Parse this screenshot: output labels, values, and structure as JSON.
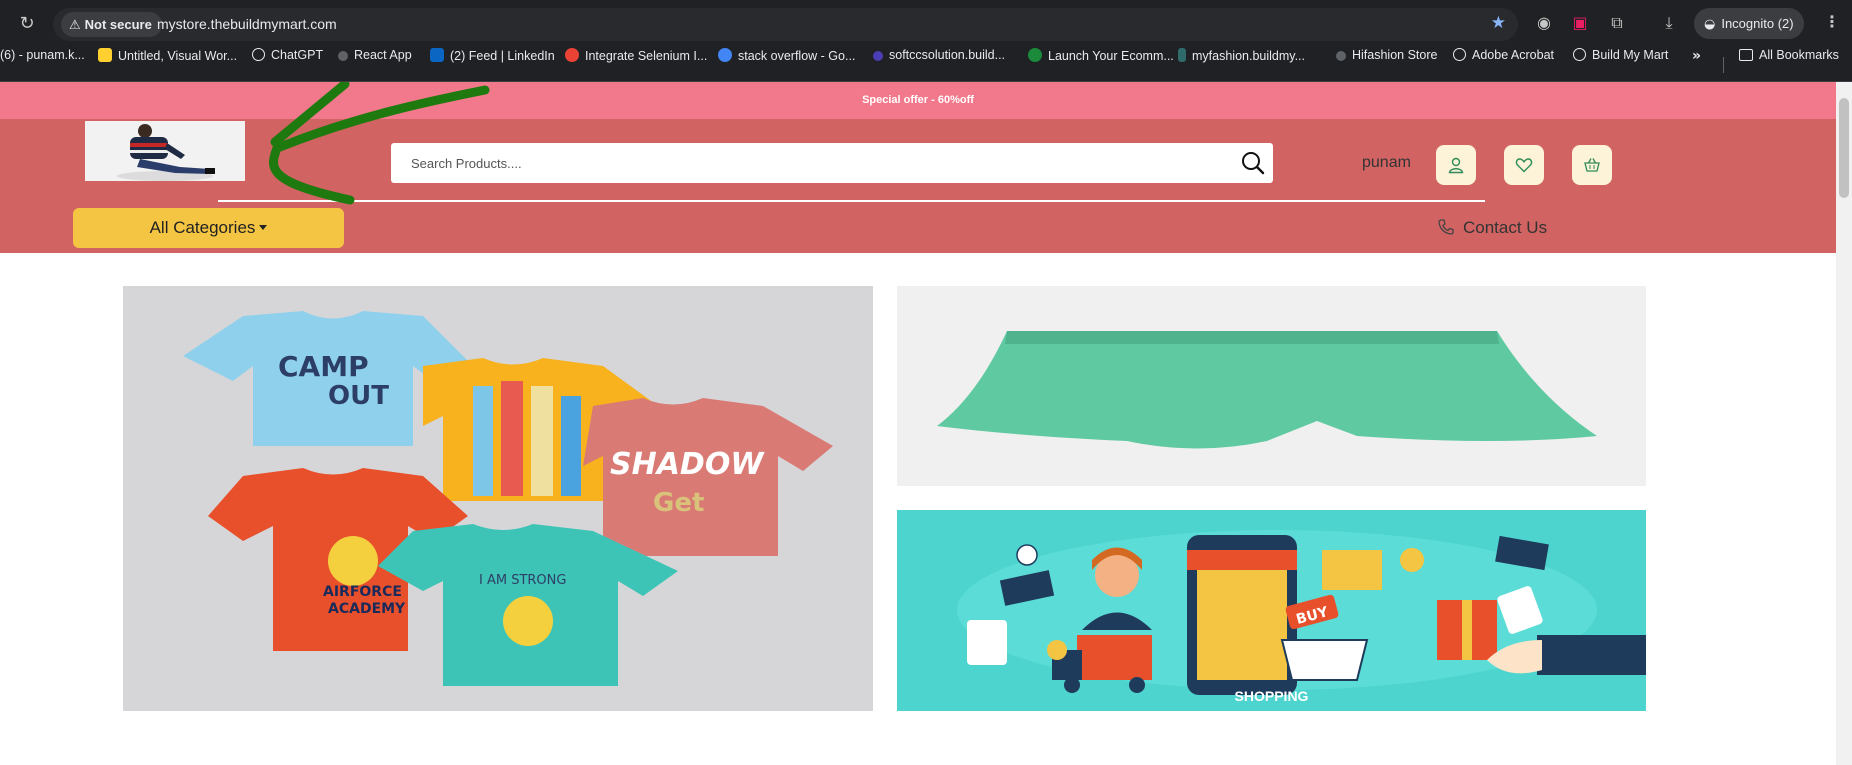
{
  "browser": {
    "security_label": "Not secure",
    "url": "mystore.thebuildmymart.com",
    "profile_label": "Incognito (2)",
    "bookmarks": [
      {
        "label": "(6) - punam.k...",
        "icon": "page-icon"
      },
      {
        "label": "Untitled, Visual Wor...",
        "icon": "miro-icon"
      },
      {
        "label": "ChatGPT",
        "icon": "chatgpt-icon"
      },
      {
        "label": "React App",
        "icon": "react-icon"
      },
      {
        "label": "(2) Feed | LinkedIn",
        "icon": "linkedin-icon"
      },
      {
        "label": "Integrate Selenium I...",
        "icon": "chrome-icon"
      },
      {
        "label": "stack overflow - Go...",
        "icon": "google-icon"
      },
      {
        "label": "softccsolution.build...",
        "icon": "site-icon"
      },
      {
        "label": "Launch Your Ecomm...",
        "icon": "site-icon"
      },
      {
        "label": "myfashion.buildmy...",
        "icon": "site-icon"
      },
      {
        "label": "Hifashion Store",
        "icon": "site-icon"
      },
      {
        "label": "Adobe Acrobat",
        "icon": "globe-icon"
      },
      {
        "label": "Build My Mart",
        "icon": "globe-icon"
      }
    ],
    "all_bookmarks_label": "All Bookmarks"
  },
  "store": {
    "promo_text": "Special offer - 60%off",
    "search_placeholder": "Search Products....",
    "username": "punam",
    "categories_label": "All Categories",
    "contact_label": "Contact Us",
    "shopping_label": "SHOPPING"
  },
  "colors": {
    "promo_bg": "#f2798c",
    "header_bg": "#d26363",
    "category_btn": "#f4c542",
    "icon_btn_bg": "#fdf3d8",
    "shopping_banner_bg": "#4dd4cf"
  }
}
